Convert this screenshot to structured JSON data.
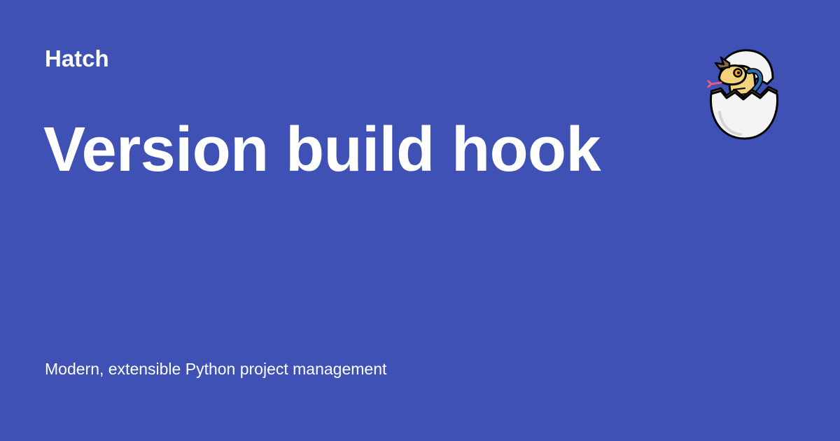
{
  "colors": {
    "background": "#3f51b5",
    "text": "#ffffff",
    "egg": "#f4f4f4",
    "egg_shell_inner": "#8a6746",
    "snake_body": "#f2d27a",
    "snake_stripe": "#2b6fb5",
    "snake_tongue": "#e35a8c"
  },
  "header": {
    "site_name": "Hatch"
  },
  "main": {
    "title": "Version build hook"
  },
  "footer": {
    "tagline": "Modern, extensible Python project management"
  },
  "logo": {
    "icon": "hatching-snake-egg-icon"
  }
}
